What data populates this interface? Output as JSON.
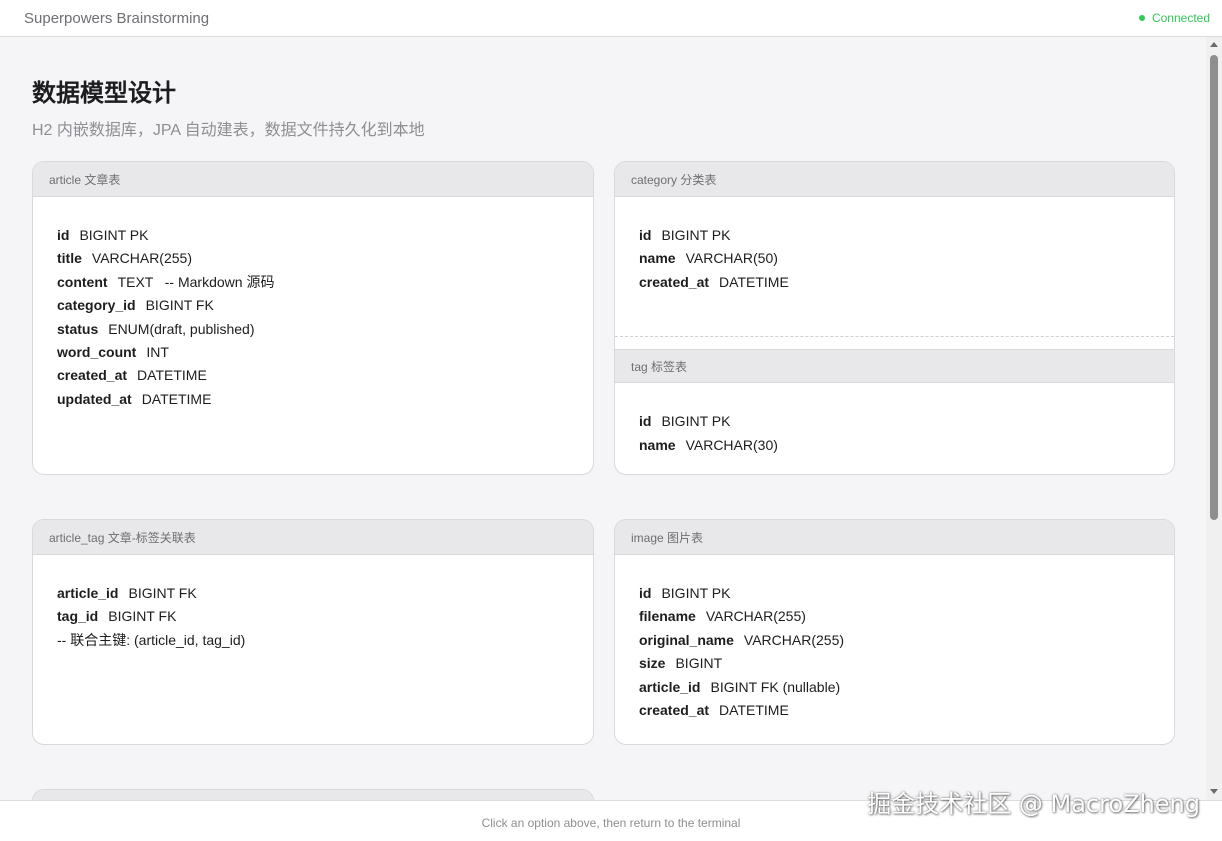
{
  "header": {
    "app_title": "Superpowers Brainstorming",
    "connection_status": "Connected",
    "status_color": "#34c759"
  },
  "page": {
    "title": "数据模型设计",
    "subtitle": "H2 内嵌数据库，JPA 自动建表，数据文件持久化到本地"
  },
  "tables": {
    "article": {
      "title": "article 文章表",
      "fields": [
        {
          "name": "id",
          "type": "BIGINT PK"
        },
        {
          "name": "title",
          "type": "VARCHAR(255)"
        },
        {
          "name": "content",
          "type": "TEXT   -- Markdown 源码"
        },
        {
          "name": "category_id",
          "type": "BIGINT FK"
        },
        {
          "name": "status",
          "type": "ENUM(draft, published)"
        },
        {
          "name": "word_count",
          "type": "INT"
        },
        {
          "name": "created_at",
          "type": "DATETIME"
        },
        {
          "name": "updated_at",
          "type": "DATETIME"
        }
      ]
    },
    "category": {
      "title": "category 分类表",
      "fields": [
        {
          "name": "id",
          "type": "BIGINT PK"
        },
        {
          "name": "name",
          "type": "VARCHAR(50)"
        },
        {
          "name": "created_at",
          "type": "DATETIME"
        }
      ]
    },
    "tag": {
      "title": "tag 标签表",
      "fields": [
        {
          "name": "id",
          "type": "BIGINT PK"
        },
        {
          "name": "name",
          "type": "VARCHAR(30)"
        }
      ]
    },
    "article_tag": {
      "title": "article_tag 文章-标签关联表",
      "fields": [
        {
          "name": "article_id",
          "type": "BIGINT FK"
        },
        {
          "name": "tag_id",
          "type": "BIGINT FK"
        }
      ],
      "note": "-- 联合主键: (article_id, tag_id)"
    },
    "image": {
      "title": "image 图片表",
      "fields": [
        {
          "name": "id",
          "type": "BIGINT PK"
        },
        {
          "name": "filename",
          "type": "VARCHAR(255)"
        },
        {
          "name": "original_name",
          "type": "VARCHAR(255)"
        },
        {
          "name": "size",
          "type": "BIGINT"
        },
        {
          "name": "article_id",
          "type": "BIGINT FK (nullable)"
        },
        {
          "name": "created_at",
          "type": "DATETIME"
        }
      ]
    }
  },
  "footer": {
    "hint": "Click an option above, then return to the terminal"
  },
  "watermark": "掘金技术社区 @ MacroZheng"
}
